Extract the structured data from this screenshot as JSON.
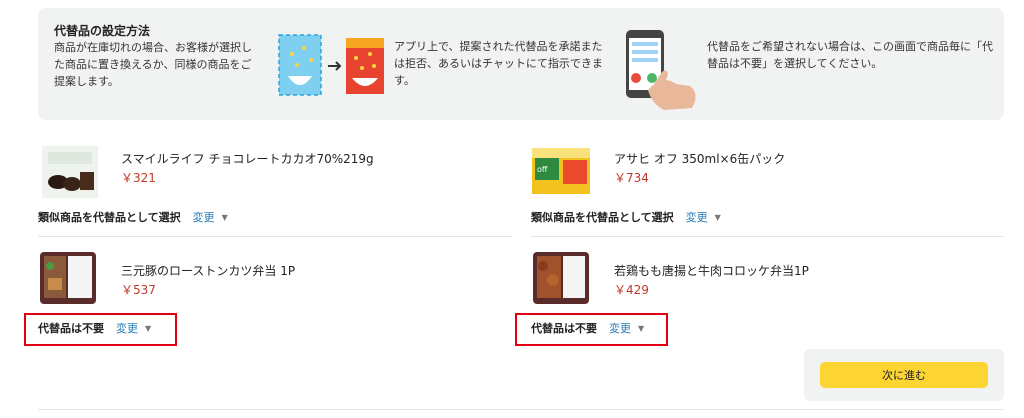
{
  "info": {
    "title": "代替品の設定方法",
    "step1": "商品が在庫切れの場合、お客様が選択した商品に置き換えるか、同様の商品をご提案します。",
    "step2": "アプリ上で、提案された代替品を承諾または拒否、あるいはチャットにて指示できます。",
    "step3": "代替品をご希望されない場合は、この画面で商品毎に「代替品は不要」を選択してください。"
  },
  "products": [
    {
      "name": "スマイルライフ チョコレートカカオ70%219g",
      "price": "￥321",
      "sub_label": "類似商品を代替品として選択",
      "change_label": "変更"
    },
    {
      "name": "アサヒ オフ 350ml×6缶パック",
      "price": "￥734",
      "sub_label": "類似商品を代替品として選択",
      "change_label": "変更"
    },
    {
      "name": "三元豚のローストンカツ弁当 1P",
      "price": "￥537",
      "sub_label": "代替品は不要",
      "change_label": "変更"
    },
    {
      "name": "若鶏もも唐揚と牛肉コロッケ弁当1P",
      "price": "￥429",
      "sub_label": "代替品は不要",
      "change_label": "変更"
    }
  ],
  "footer": {
    "next_label": "次に進む"
  },
  "colors": {
    "accent_button": "#fcd533",
    "price": "#c0392b",
    "link": "#2a7db8",
    "highlight": "#e00012"
  }
}
